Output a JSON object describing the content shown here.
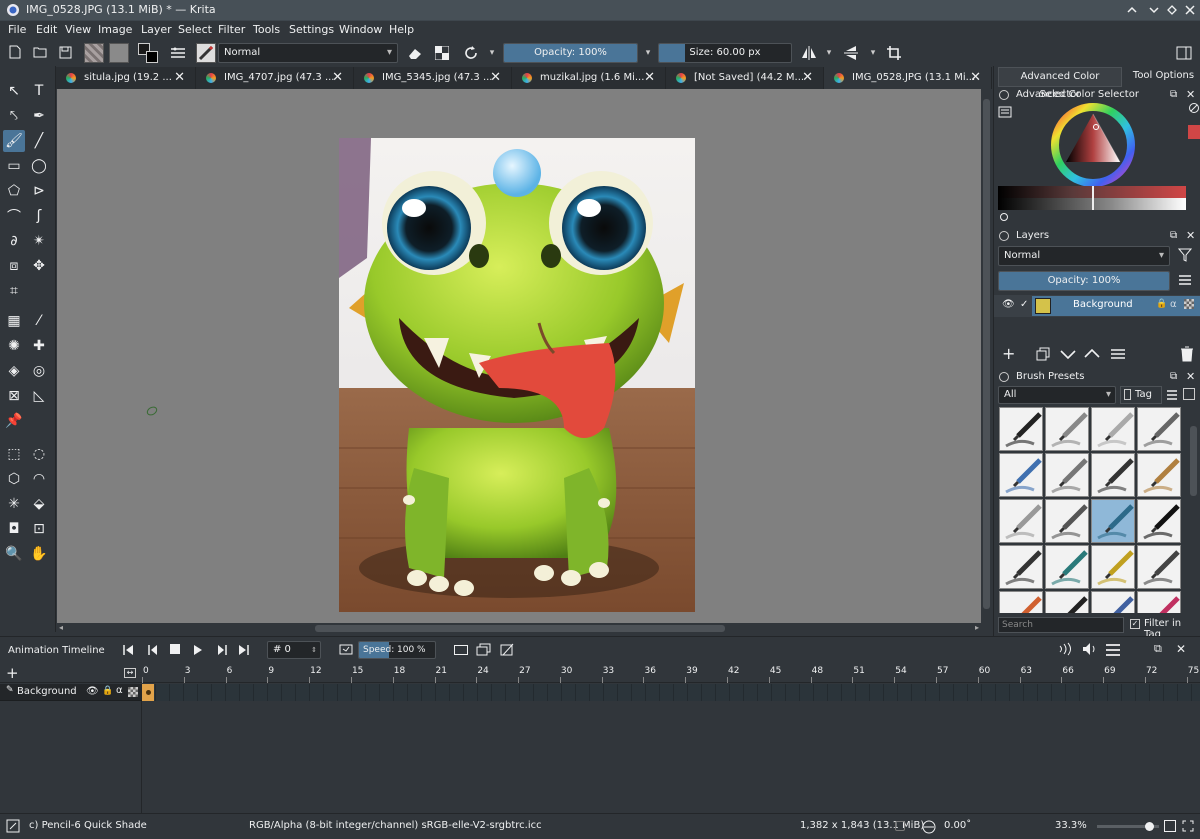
{
  "window": {
    "title": "IMG_0528.JPG (13.1 MiB) * — Krita"
  },
  "menu": [
    "File",
    "Edit",
    "View",
    "Image",
    "Layer",
    "Select",
    "Filter",
    "Tools",
    "Settings",
    "Window",
    "Help"
  ],
  "toolbar": {
    "blend_mode": "Normal",
    "opacity_label": "Opacity: 100%",
    "opacity_value": 1.0,
    "size_label": "Size: 60.00 px",
    "size_value": 0.2
  },
  "tabs": [
    {
      "label": "situla.jpg (19.2 ..."
    },
    {
      "label": "IMG_4707.jpg (47.3 ..."
    },
    {
      "label": "IMG_5345.jpg (47.3 ..."
    },
    {
      "label": "muzikal.jpg (1.6 Mi..."
    },
    {
      "label": "[Not Saved] (44.2 M..."
    },
    {
      "label": "IMG_0528.JPG (13.1 Mi..."
    }
  ],
  "dock": {
    "tab_color": "Advanced Color Selector",
    "tab_tool": "Tool Options",
    "color_selector_title": "Advanced Color Selector",
    "layers_title": "Layers",
    "layers_blend": "Normal",
    "layers_opacity": "Opacity:  100%",
    "layer_name": "Background",
    "brush_presets_title": "Brush Presets",
    "brush_filter": "All",
    "brush_tag": "Tag",
    "brush_search_placeholder": "Search",
    "filter_in_tag": "Filter in Tag"
  },
  "timeline": {
    "title": "Animation Timeline",
    "frame_field": "# 0",
    "speed_label": "Speed:",
    "speed_value": "100 %",
    "layer_name": "Background",
    "ruler": [
      "0",
      "3",
      "6",
      "9",
      "12",
      "15",
      "18",
      "21",
      "24",
      "27",
      "30",
      "33",
      "36",
      "39",
      "42",
      "45",
      "48",
      "51",
      "54",
      "57",
      "60",
      "63",
      "66",
      "69",
      "72",
      "75"
    ]
  },
  "status": {
    "brush": "c) Pencil-6 Quick Shade",
    "color_space": "RGB/Alpha (8-bit integer/channel)  sRGB-elle-V2-srgbtrc.icc",
    "dimensions": "1,382 x 1,843 (13.1 MiB)",
    "rotation": "0.00˚",
    "zoom": "33.3%"
  },
  "colors": {
    "accent": "#4a7598",
    "bg": "#31363b",
    "canvas": "#808080"
  }
}
